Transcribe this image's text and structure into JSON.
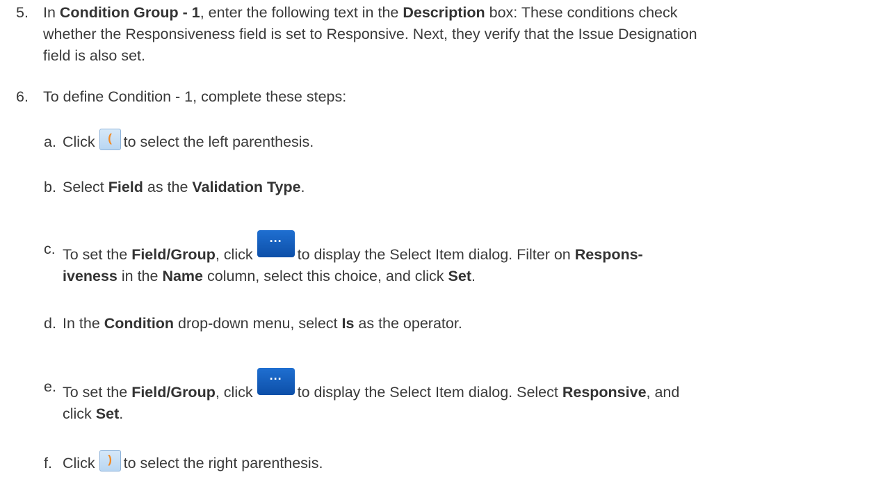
{
  "step5": {
    "num": "5.",
    "t1": "In ",
    "b1": "Condition Group - 1",
    "t2": ", enter the following text in the ",
    "b2": "Description",
    "t3": " box: These conditions check",
    "line2": "whether the Responsiveness field is set to Responsive. Next, they verify that the Issue Designation",
    "line3": "field is also set."
  },
  "step6": {
    "num": "6.",
    "text": "To define Condition - 1, complete these steps:"
  },
  "sub_a": {
    "letter": "a.",
    "t1": "Click",
    "icon": "(",
    "t2": "to select the left parenthesis."
  },
  "sub_b": {
    "letter": "b.",
    "t1": "Select ",
    "b1": "Field",
    "t2": " as the ",
    "b2": "Validation Type",
    "t3": "."
  },
  "sub_c": {
    "letter": "c.",
    "t1": "To set the ",
    "b1": "Field/Group",
    "t2": ", click",
    "icon": "...",
    "t3": "to display the Select Item dialog. Filter on ",
    "b2": "Respons-",
    "b3": "iveness",
    "t4": " in the ",
    "b4": "Name",
    "t5": " column, select this choice, and click ",
    "b5": "Set",
    "t6": "."
  },
  "sub_d": {
    "letter": "d.",
    "t1": "In the ",
    "b1": "Condition",
    "t2": " drop-down menu, select ",
    "b2": "Is",
    "t3": " as the operator."
  },
  "sub_e": {
    "letter": "e.",
    "t1": "To set the ",
    "b1": "Field/Group",
    "t2": ", click",
    "icon": "...",
    "t3": "to display the Select Item dialog. Select ",
    "b2": "Responsive",
    "t4": ", and",
    "t5": "click ",
    "b3": "Set",
    "t6": "."
  },
  "sub_f": {
    "letter": "f.",
    "t1": "Click",
    "icon": ")",
    "t2": "to select the right parenthesis."
  }
}
